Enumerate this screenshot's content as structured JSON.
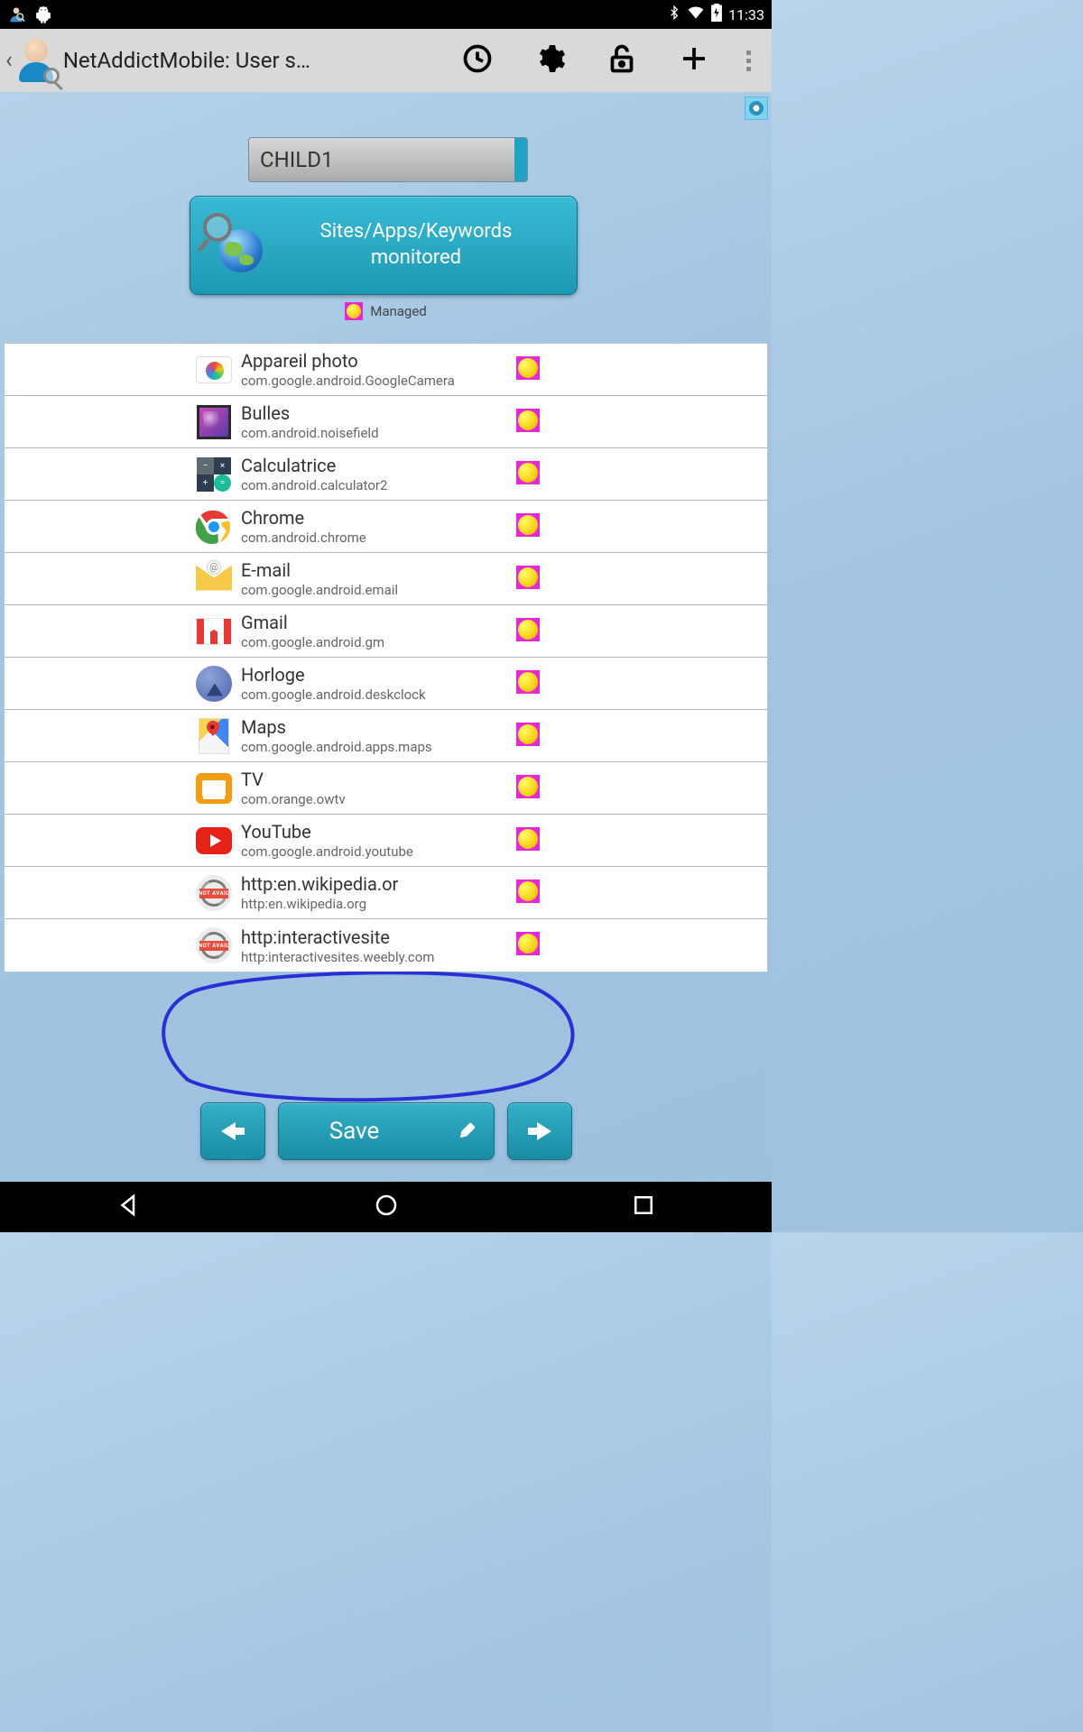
{
  "status": {
    "time": "11:33"
  },
  "actionBar": {
    "title": "NetAddictMobile: User s…"
  },
  "userDropdown": {
    "value": "CHILD1"
  },
  "monitoredButton": {
    "line1": "Sites/Apps/Keywords",
    "line2": "monitored"
  },
  "legend": {
    "label": "Managed"
  },
  "list": [
    {
      "title": "Appareil photo",
      "sub": "com.google.android.GoogleCamera",
      "icon": "camera"
    },
    {
      "title": "Bulles",
      "sub": "com.android.noisefield",
      "icon": "bulles"
    },
    {
      "title": "Calculatrice",
      "sub": "com.android.calculator2",
      "icon": "calc"
    },
    {
      "title": "Chrome",
      "sub": "com.android.chrome",
      "icon": "chrome"
    },
    {
      "title": "E-mail",
      "sub": "com.google.android.email",
      "icon": "email"
    },
    {
      "title": "Gmail",
      "sub": "com.google.android.gm",
      "icon": "gmail"
    },
    {
      "title": "Horloge",
      "sub": "com.google.android.deskclock",
      "icon": "clock"
    },
    {
      "title": "Maps",
      "sub": "com.google.android.apps.maps",
      "icon": "maps"
    },
    {
      "title": "TV",
      "sub": "com.orange.owtv",
      "icon": "tv"
    },
    {
      "title": "YouTube",
      "sub": "com.google.android.youtube",
      "icon": "youtube"
    },
    {
      "title": "http:en.wikipedia.or",
      "sub": "http:en.wikipedia.org",
      "icon": "noimg"
    },
    {
      "title": "http:interactivesite",
      "sub": "http:interactivesites.weebly.com",
      "icon": "noimg"
    }
  ],
  "bottomBar": {
    "save": "Save"
  }
}
